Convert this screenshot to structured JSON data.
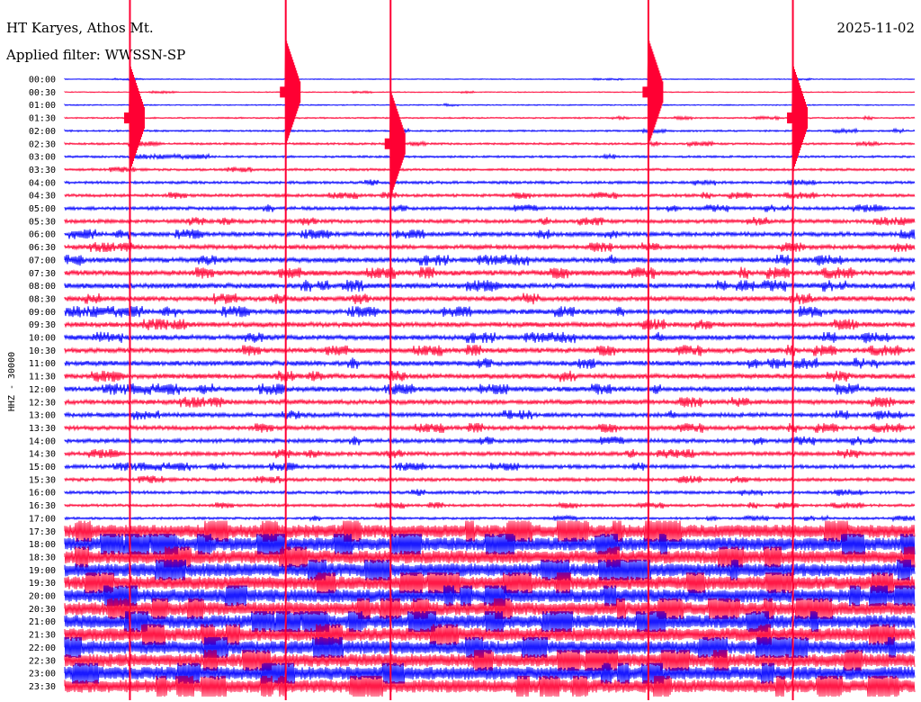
{
  "header": {
    "station": "HT Karyes, Athos Mt.",
    "date": "2025-11-02",
    "filter": "Applied filter: WWSSN-SP"
  },
  "chart_data": {
    "type": "seismogram-helicorder",
    "ylabel": "HHZ - 30000",
    "trace_colors": [
      "#0000ff",
      "#ff0033"
    ],
    "row_labels": [
      "00:00",
      "00:30",
      "01:00",
      "01:30",
      "02:00",
      "02:30",
      "03:00",
      "03:30",
      "04:00",
      "04:30",
      "05:00",
      "05:30",
      "06:00",
      "06:30",
      "07:00",
      "07:30",
      "08:00",
      "08:30",
      "09:00",
      "09:30",
      "10:00",
      "10:30",
      "11:00",
      "11:30",
      "12:00",
      "12:30",
      "13:00",
      "13:30",
      "14:00",
      "14:30",
      "15:00",
      "15:30",
      "16:00",
      "16:30",
      "17:00",
      "17:30",
      "18:00",
      "18:30",
      "19:00",
      "19:30",
      "20:00",
      "20:30",
      "21:00",
      "21:30",
      "22:00",
      "22:30",
      "23:00",
      "23:30"
    ],
    "noise_level": [
      0.05,
      0.08,
      0.1,
      0.15,
      0.2,
      0.25,
      0.25,
      0.3,
      0.35,
      0.4,
      0.45,
      0.5,
      0.6,
      0.6,
      0.7,
      0.75,
      0.75,
      0.7,
      0.7,
      0.7,
      0.7,
      0.7,
      0.7,
      0.7,
      0.7,
      0.65,
      0.6,
      0.6,
      0.55,
      0.55,
      0.5,
      0.45,
      0.4,
      0.35,
      0.3,
      1.0,
      1.0,
      1.0,
      1.0,
      1.0,
      1.0,
      1.0,
      1.0,
      1.0,
      1.0,
      1.0,
      1.0,
      1.0
    ],
    "large_events": [
      {
        "row": 1,
        "minute": 7.8
      },
      {
        "row": 1,
        "minute": 20.6
      },
      {
        "row": 3,
        "minute": 2.3
      },
      {
        "row": 3,
        "minute": 25.7
      },
      {
        "row": 5,
        "minute": 11.5
      }
    ]
  }
}
